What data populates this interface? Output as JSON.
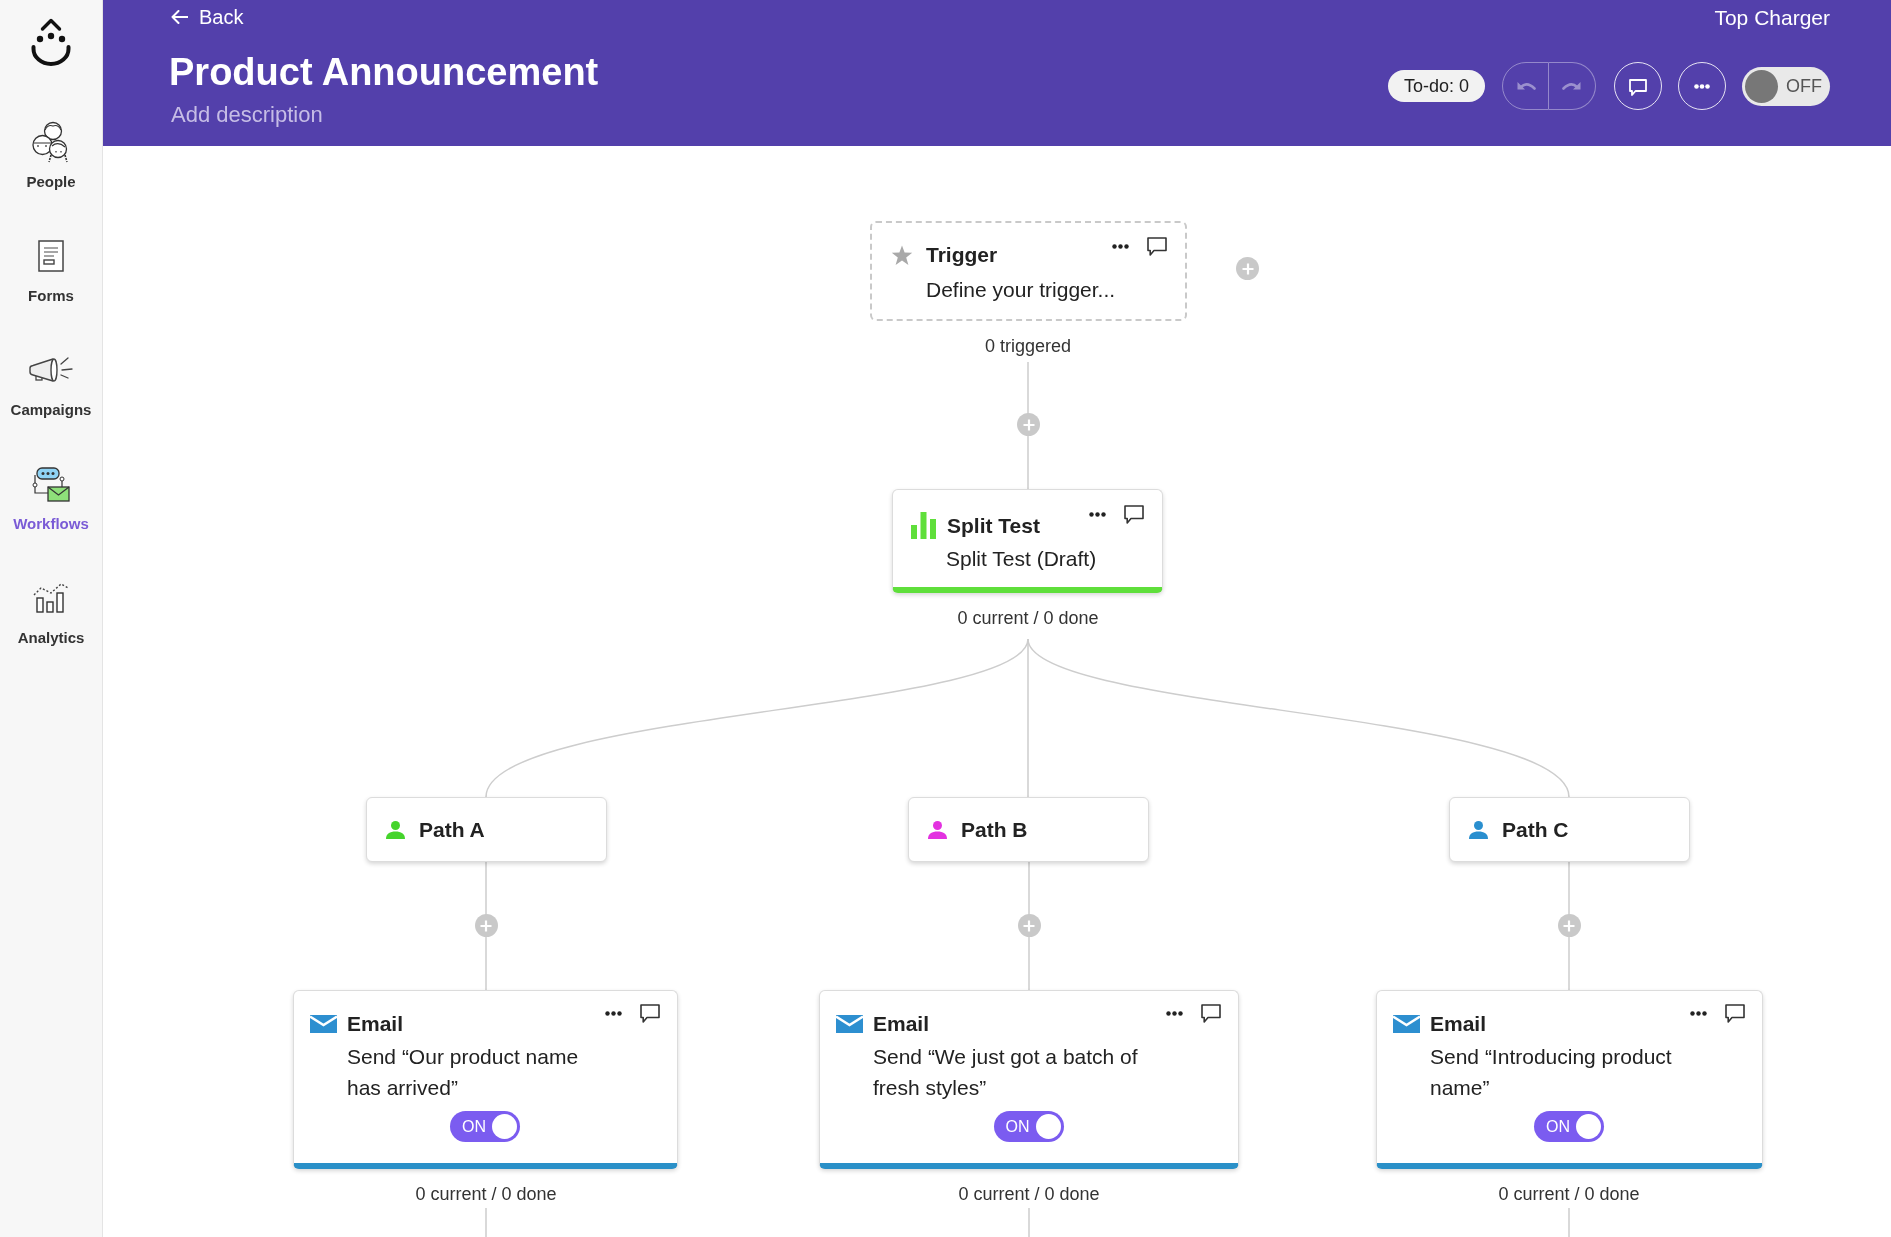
{
  "sidebar": {
    "items": [
      {
        "label": "People",
        "selected": false
      },
      {
        "label": "Forms",
        "selected": false
      },
      {
        "label": "Campaigns",
        "selected": false
      },
      {
        "label": "Workflows",
        "selected": true
      },
      {
        "label": "Analytics",
        "selected": false
      }
    ]
  },
  "header": {
    "back": "Back",
    "title": "Product Announcement",
    "description": {
      "placeholder": "Add description"
    },
    "account": "Top Charger",
    "todo": "To-do: 0",
    "undo": {
      "disabled": true
    },
    "redo": {
      "disabled": true
    },
    "toggle": {
      "on": false,
      "label": "OFF"
    }
  },
  "workflow": {
    "trigger": {
      "title": "Trigger",
      "subtitle": "Define your trigger...",
      "stat": "0 triggered"
    },
    "split_test": {
      "title": "Split Test",
      "subtitle": "Split Test (Draft)",
      "stat": "0 current / 0 done"
    },
    "paths": [
      {
        "label": "Path A",
        "color": "#45d42c",
        "email": {
          "title": "Email",
          "description": "Send “Our product name has arrived”",
          "toggle": {
            "on": true,
            "label": "ON"
          },
          "stat": "0 current / 0 done"
        }
      },
      {
        "label": "Path B",
        "color": "#e332e0",
        "email": {
          "title": "Email",
          "description": "Send “We just got a batch of fresh styles”",
          "toggle": {
            "on": true,
            "label": "ON"
          },
          "stat": "0 current / 0 done"
        }
      },
      {
        "label": "Path C",
        "color": "#2a8fcf",
        "email": {
          "title": "Email",
          "description": "Send “Introducing product name”",
          "toggle": {
            "on": true,
            "label": "ON"
          },
          "stat": "0 current / 0 done"
        }
      }
    ]
  }
}
